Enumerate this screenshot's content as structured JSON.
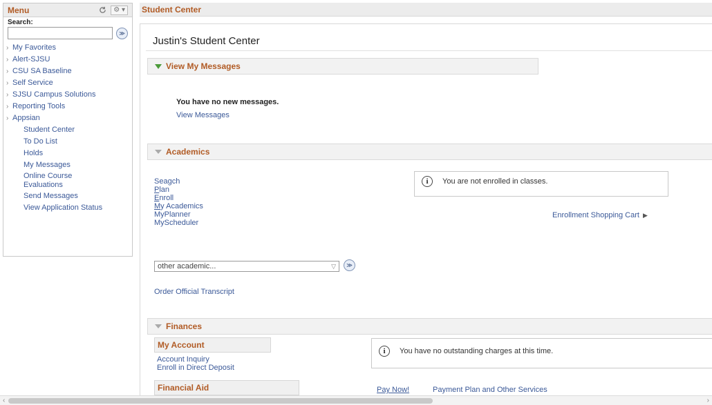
{
  "menu": {
    "title": "Menu",
    "refresh_icon": "refresh-icon",
    "options_icon": "gear-icon",
    "search_label": "Search:",
    "search_value": "",
    "folders": [
      "My Favorites",
      "Alert-SJSU",
      "CSU SA Baseline",
      "Self Service",
      "SJSU Campus Solutions",
      "Reporting Tools",
      "Appsian"
    ],
    "leaves": [
      "Student Center",
      "To Do List",
      "Holds",
      "My Messages",
      "Online Course Evaluations",
      "Send Messages",
      "View Application Status"
    ]
  },
  "main": {
    "title": "Student Center",
    "heading": "Justin's Student Center",
    "messages": {
      "title": "View My Messages",
      "status": "You have no new messages.",
      "link": "View Messages"
    },
    "academics": {
      "title": "Academics",
      "links": [
        "Seagch",
        "Plan",
        "Enroll",
        "My Academics",
        "MyPlanner",
        "MyScheduler"
      ],
      "info": "You are not enrolled in classes.",
      "cart_link": "Enrollment Shopping Cart",
      "dropdown_value": "other academic...",
      "transcript_link": "Order Official Transcript"
    },
    "finances": {
      "title": "Finances",
      "my_account": "My Account",
      "account_links": [
        "Account Inquiry",
        "Enroll in Direct Deposit"
      ],
      "financial_aid": "Financial Aid",
      "info": "You have no outstanding charges at this time.",
      "pay_now": "Pay Now!",
      "payment_plan": "Payment Plan and Other Services"
    }
  },
  "colors": {
    "accent": "#b15b25",
    "link": "#3b5998",
    "expand_green": "#4b9a3a"
  }
}
